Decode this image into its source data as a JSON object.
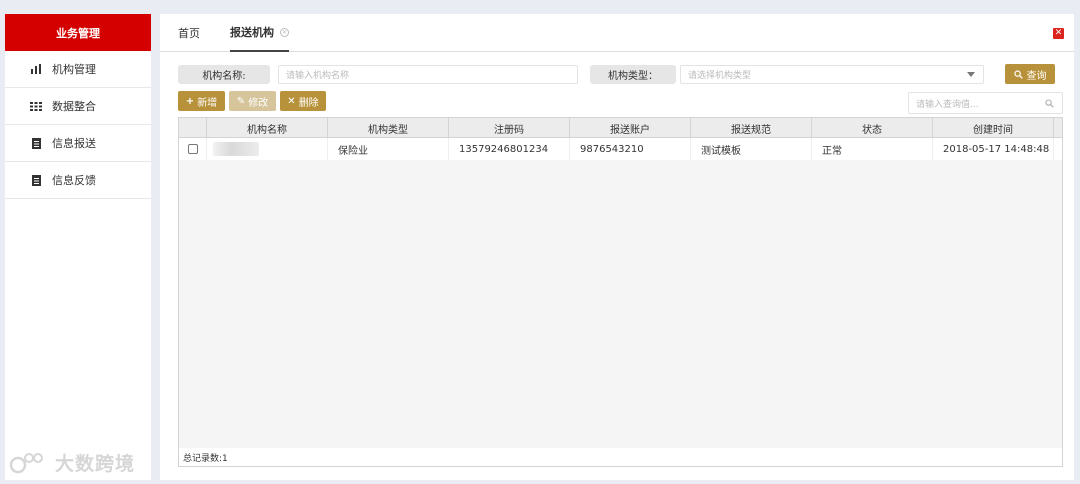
{
  "sidebar": {
    "title": "业务管理",
    "items": [
      {
        "label": "机构管理",
        "icon": "bar-chart-icon"
      },
      {
        "label": "数据整合",
        "icon": "grid-icon"
      },
      {
        "label": "信息报送",
        "icon": "document-icon"
      },
      {
        "label": "信息反馈",
        "icon": "document-icon"
      }
    ],
    "watermark": "大数跨境"
  },
  "tabs": [
    {
      "label": "首页",
      "active": false
    },
    {
      "label": "报送机构",
      "active": true
    }
  ],
  "search": {
    "name_label": "机构名称:",
    "name_placeholder": "请输入机构名称",
    "type_label": "机构类型：",
    "type_placeholder": "请选择机构类型",
    "query_button": "查询"
  },
  "toolbar": {
    "add_label": "新增",
    "edit_label": "修改",
    "delete_label": "删除",
    "quick_search_placeholder": "请输入查询值..."
  },
  "table": {
    "columns": [
      "机构名称",
      "机构类型",
      "注册码",
      "报送账户",
      "报送规范",
      "状态",
      "创建时间"
    ],
    "rows": [
      {
        "name": "",
        "type": "保险业",
        "reg_code": "13579246801234",
        "account": "9876543210",
        "spec": "测试模板",
        "status": "正常",
        "created": "2018-05-17 14:48:48"
      }
    ]
  },
  "footer": {
    "total_label": "总记录数:1"
  },
  "colors": {
    "brand_red": "#d40000",
    "button_gold": "#b8923a",
    "close_red": "#d9251d"
  }
}
